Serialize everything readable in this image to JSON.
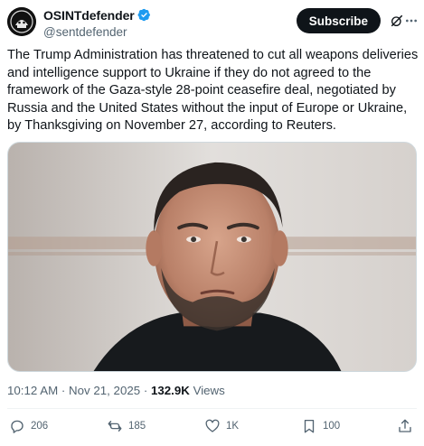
{
  "author": {
    "display_name": "OSINTdefender",
    "handle": "@sentdefender",
    "verified": true,
    "avatar_icon": "osint-logo-icon"
  },
  "header": {
    "subscribe_label": "Subscribe",
    "grok_icon": "grok-icon",
    "more_icon": "more-icon"
  },
  "tweet": {
    "text": "The Trump Administration has threatened to cut all weapons deliveries and intelligence support to Ukraine if they do not agreed to the framework of the Gaza-style 28-point ceasefire deal, negotiated by Russia and the United States without the input of Europe or Ukraine, by Thanksgiving on November 27, according to Reuters."
  },
  "meta": {
    "time": "10:12 AM",
    "separator": "·",
    "date": "Nov 21, 2025",
    "views_count": "132.9K",
    "views_label": "Views"
  },
  "actions": {
    "reply_count": "206",
    "repost_count": "185",
    "like_count": "1K",
    "bookmark_count": "100"
  },
  "colors": {
    "primary_text": "#0f1419",
    "secondary_text": "#536471",
    "verified_blue": "#1d9bf0",
    "subscribe_bg": "#0f1419"
  }
}
